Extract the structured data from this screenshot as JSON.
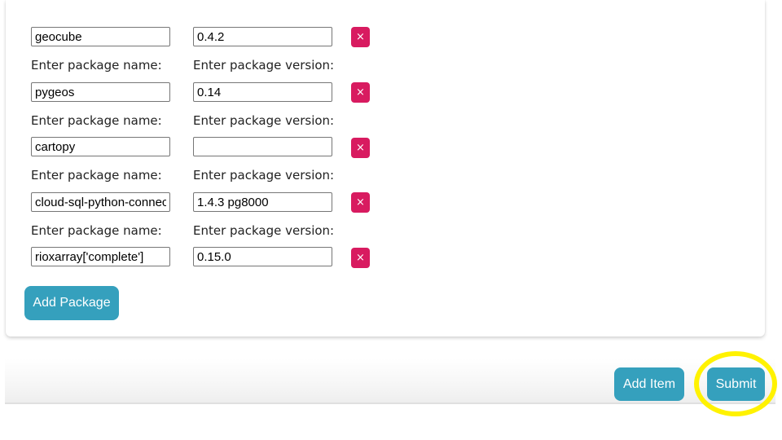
{
  "packages": [
    {
      "name_label": "",
      "version_label": "",
      "name": "geocube",
      "version": "0.4.2",
      "delete_label": "×"
    },
    {
      "name_label": "Enter package name:",
      "version_label": "Enter package version:",
      "name": "pygeos",
      "version": "0.14",
      "delete_label": "×"
    },
    {
      "name_label": "Enter package name:",
      "version_label": "Enter package version:",
      "name": "cartopy",
      "version": "",
      "delete_label": "×"
    },
    {
      "name_label": "Enter package name:",
      "version_label": "Enter package version:",
      "name": "cloud-sql-python-connector",
      "version": "1.4.3 pg8000",
      "delete_label": "×"
    },
    {
      "name_label": "Enter package name:",
      "version_label": "Enter package version:",
      "name": "rioxarray['complete']",
      "version": "0.15.0",
      "delete_label": "×"
    }
  ],
  "actions": {
    "add_package_label": "Add Package",
    "add_item_label": "Add Item",
    "submit_label": "Submit"
  },
  "colors": {
    "primary": "#35a0bd",
    "danger": "#d81b60",
    "highlight": "#fff200"
  }
}
